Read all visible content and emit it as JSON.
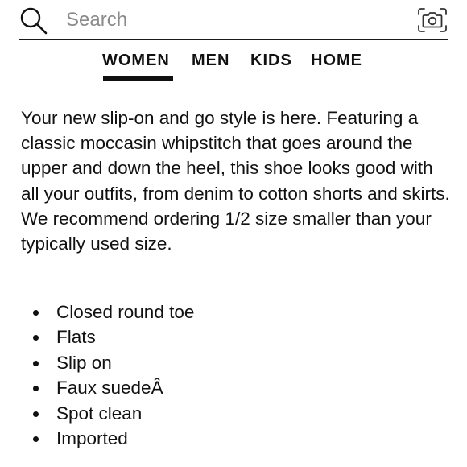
{
  "search": {
    "placeholder": "Search",
    "icon": "search-icon",
    "camera_icon": "camera-icon"
  },
  "nav": {
    "tabs": [
      {
        "label": "WOMEN",
        "active": true
      },
      {
        "label": "MEN",
        "active": false
      },
      {
        "label": "KIDS",
        "active": false
      },
      {
        "label": "HOME",
        "active": false
      }
    ]
  },
  "description": {
    "text": "Your new slip-on and go style is here. Featuring a classic moccasin whipstitch that goes around the upper and down the heel, this shoe looks good with all your outfits, from denim to cotton shorts and skirts. We recommend ordering 1/2 size smaller than your typically used size."
  },
  "features": [
    "Closed round toe",
    "Flats",
    "Slip on",
    "Faux suedeÂ",
    "Spot clean",
    "Imported"
  ]
}
